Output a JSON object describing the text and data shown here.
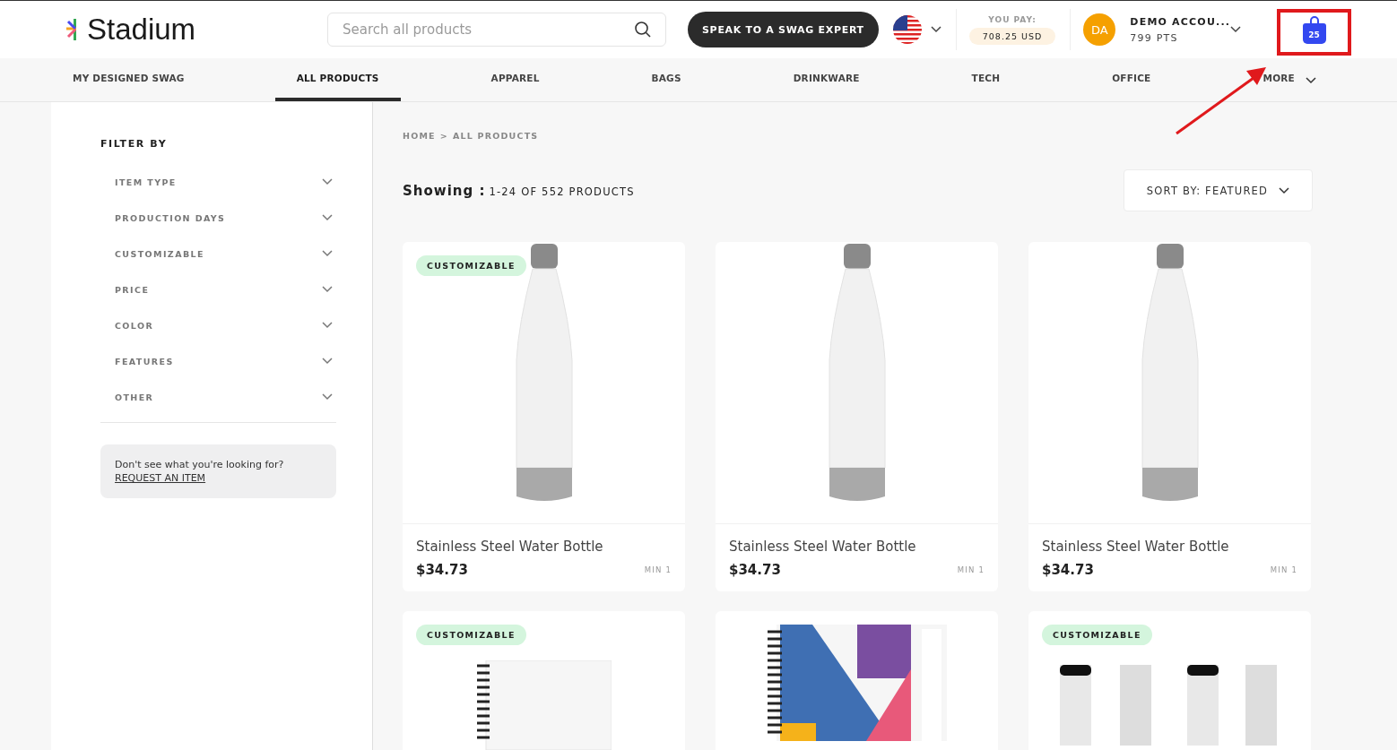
{
  "header": {
    "logo": "Stadium",
    "search": {
      "placeholder": "Search all products"
    },
    "expert_button": "SPEAK TO A SWAG EXPERT",
    "you_pay": {
      "label": "YOU PAY:",
      "amount": "708.25 USD"
    },
    "account": {
      "initials": "DA",
      "name": "DEMO ACCOU...",
      "points": "799 PTS"
    },
    "cart": {
      "count": "25"
    }
  },
  "nav": [
    {
      "label": "MY DESIGNED SWAG",
      "selected": false
    },
    {
      "label": "ALL PRODUCTS",
      "selected": true
    },
    {
      "label": "APPAREL",
      "selected": false
    },
    {
      "label": "BAGS",
      "selected": false
    },
    {
      "label": "DRINKWARE",
      "selected": false
    },
    {
      "label": "TECH",
      "selected": false
    },
    {
      "label": "OFFICE",
      "selected": false
    },
    {
      "label": "MORE",
      "selected": false
    }
  ],
  "sidebar": {
    "title": "FILTER BY",
    "filters": [
      "ITEM TYPE",
      "PRODUCTION DAYS",
      "CUSTOMIZABLE",
      "PRICE",
      "COLOR",
      "FEATURES",
      "OTHER"
    ],
    "request": {
      "text": "Don't see what you're looking for?",
      "link": "REQUEST AN ITEM"
    }
  },
  "breadcrumb": [
    "HOME",
    ">",
    "ALL PRODUCTS"
  ],
  "showing": {
    "label": "Showing :",
    "count": "1-24 OF 552 PRODUCTS"
  },
  "sort": "SORT BY: FEATURED",
  "products": [
    {
      "kind": "bottle",
      "badge": "CUSTOMIZABLE",
      "name": "Stainless Steel Water Bottle",
      "price": "$34.73",
      "min": "MIN 1"
    },
    {
      "kind": "bottle",
      "name": "Stainless Steel Water Bottle",
      "price": "$34.73",
      "min": "MIN 1"
    },
    {
      "kind": "bottle",
      "name": "Stainless Steel Water Bottle",
      "price": "$34.73",
      "min": "MIN 1"
    },
    {
      "kind": "notebook",
      "badge": "CUSTOMIZABLE"
    },
    {
      "kind": "notebook-print"
    },
    {
      "kind": "socks",
      "badge": "CUSTOMIZABLE"
    }
  ]
}
